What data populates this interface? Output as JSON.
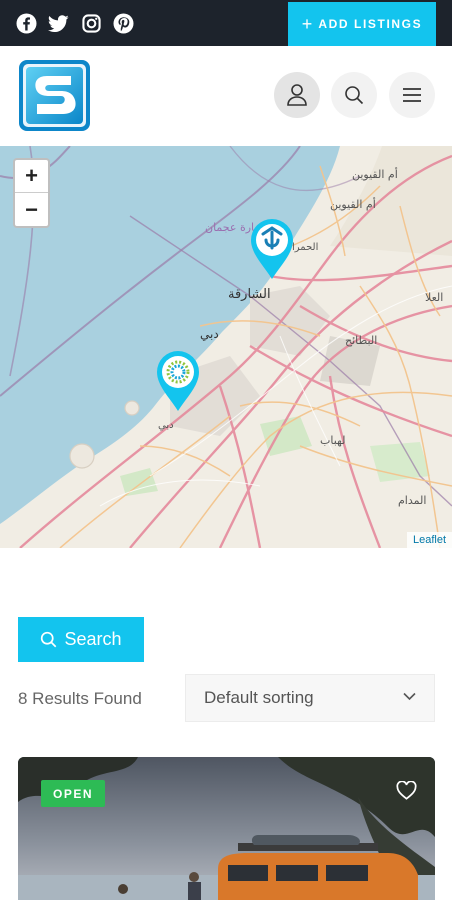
{
  "topbar": {
    "social_icons": [
      "facebook-icon",
      "twitter-icon",
      "instagram-icon",
      "pinterest-icon"
    ],
    "add_listings_label": "ADD LISTINGS"
  },
  "header": {
    "logo_letter": "S",
    "icons": [
      "user-icon",
      "search-icon",
      "menu-icon"
    ]
  },
  "map": {
    "zoom_in": "+",
    "zoom_out": "−",
    "attribution": "Leaflet",
    "labels": [
      {
        "text": "أم القيوين"
      },
      {
        "text": "أم القيوين"
      },
      {
        "text": "إمارة عجمان"
      },
      {
        "text": "الحمرا"
      },
      {
        "text": "الشارقة"
      },
      {
        "text": "دبي"
      },
      {
        "text": "العلا"
      },
      {
        "text": "البطائح"
      },
      {
        "text": "لهباب"
      },
      {
        "text": "المدام"
      },
      {
        "text": "دبي"
      }
    ]
  },
  "search": {
    "button_label": "Search"
  },
  "results": {
    "count_text": "8 Results Found"
  },
  "sorting": {
    "selected": "Default sorting"
  },
  "card": {
    "status_badge": "OPEN"
  },
  "colors": {
    "accent": "#13c4ee",
    "topbar": "#1d232c",
    "open": "#2dbb55"
  }
}
